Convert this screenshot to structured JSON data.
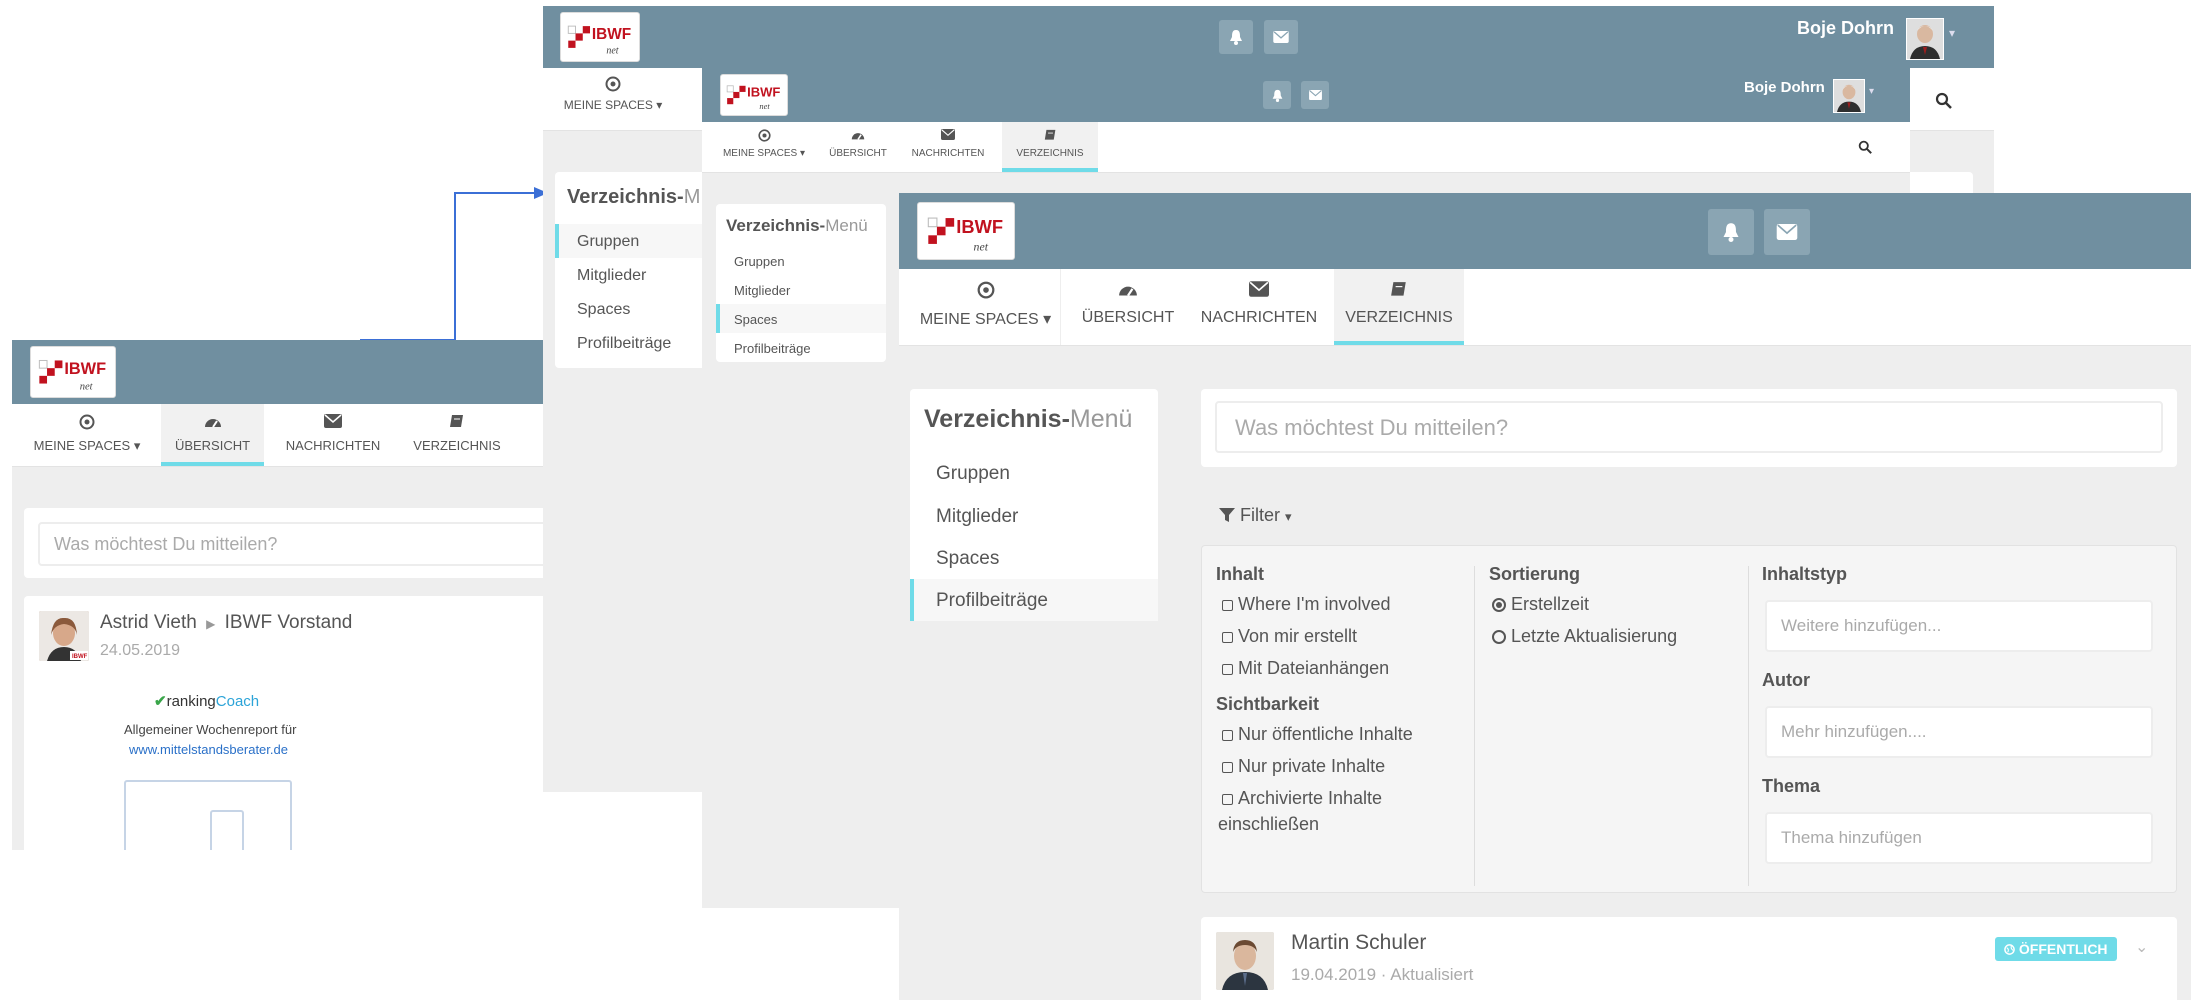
{
  "brand": {
    "logo_text": "IBWF",
    "logo_sub": "net"
  },
  "nav": {
    "spaces_label": "MEINE SPACES",
    "overview_label": "ÜBERSICHT",
    "messages_label": "NACHRICHTEN",
    "directory_label": "VERZEICHNIS"
  },
  "user": {
    "name": "Boje Dohrn"
  },
  "colors": {
    "topbar": "#708fa0",
    "accent": "#6fdbe8",
    "badge": "#6fdbe8"
  },
  "directory_menu": {
    "title_bold": "Verzeichnis-",
    "title_light": "Menü",
    "title_light_short": "M",
    "items": [
      "Gruppen",
      "Mitglieder",
      "Spaces",
      "Profilbeiträge"
    ]
  },
  "stream": {
    "compose_placeholder": "Was möchtest Du mitteilen?"
  },
  "post1": {
    "author": "Astrid Vieth",
    "space": "IBWF Vorstand",
    "date": "24.05.2019",
    "card_brand_a": "ranking",
    "card_brand_b": "Coach",
    "card_line": "Allgemeiner Wochenreport für",
    "card_link": "www.mittelstandsberater.de"
  },
  "filter": {
    "toggle_label": "Filter",
    "content_head": "Inhalt",
    "content_opts": [
      "Where I'm involved",
      "Von mir erstellt",
      "Mit Dateianhängen"
    ],
    "visibility_head": "Sichtbarkeit",
    "visibility_opts": [
      "Nur öffentliche Inhalte",
      "Nur private Inhalte"
    ],
    "archived_1": "Archivierte Inhalte",
    "archived_2": "einschließen",
    "sort_head": "Sortierung",
    "sort_opts": [
      "Erstellzeit",
      "Letzte Aktualisierung"
    ],
    "type_head": "Inhaltstyp",
    "type_placeholder": "Weitere hinzufügen...",
    "author_head": "Autor",
    "author_placeholder": "Mehr hinzufügen....",
    "topic_head": "Thema",
    "topic_placeholder": "Thema hinzufügen"
  },
  "post2": {
    "author": "Martin Schuler",
    "meta": "19.04.2019 · Aktualisiert",
    "badge": "ÖFFENTLICH"
  },
  "icons": [
    "bell-icon",
    "envelope-icon",
    "search-icon",
    "dashboard-icon",
    "book-icon",
    "target-icon",
    "filter-icon",
    "globe-icon",
    "chevron-down-icon",
    "caret-right-icon",
    "user-photo"
  ]
}
